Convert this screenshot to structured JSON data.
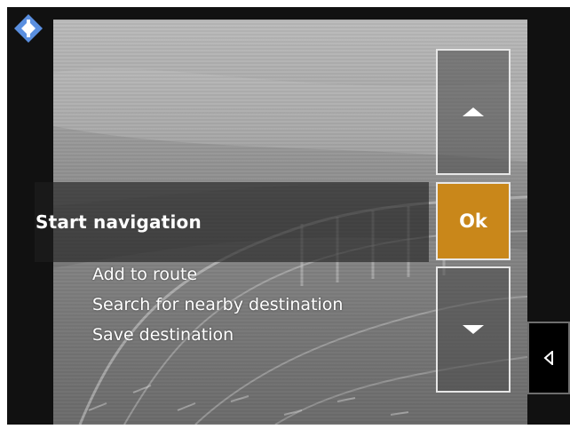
{
  "menu": {
    "selected": "Start navigation",
    "options": [
      "Add to route",
      "Search for nearby destination",
      "Save destination"
    ]
  },
  "controls": {
    "ok_label": "Ok",
    "up_icon": "triangle-up-icon",
    "down_icon": "triangle-down-icon",
    "side_icon": "triangle-left-icon"
  },
  "colors": {
    "accent": "#c9871a",
    "logo": "#5a8fe0",
    "frame": "#111111"
  }
}
